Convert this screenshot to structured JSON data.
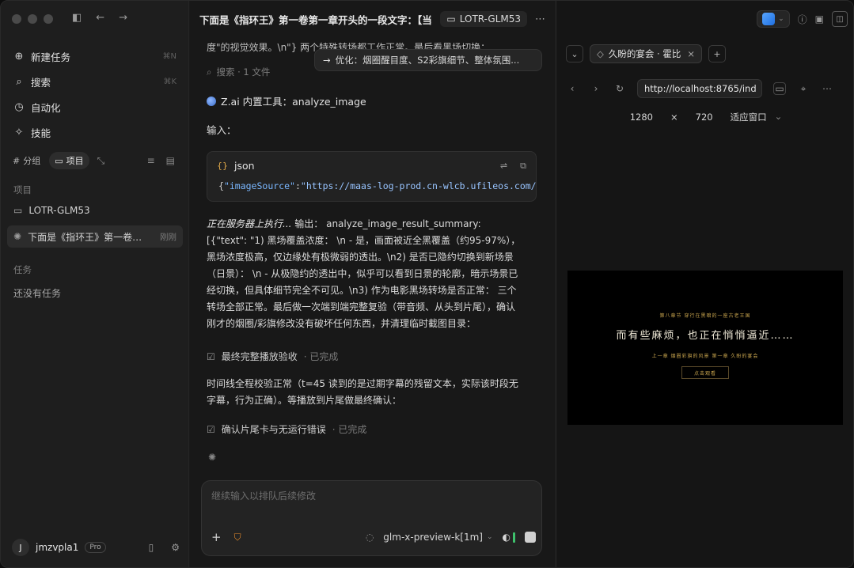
{
  "sidebar": {
    "nav": [
      {
        "label": "新建任务",
        "icon": "new-task-icon",
        "kbd": "⌘N"
      },
      {
        "label": "搜索",
        "icon": "search-icon",
        "kbd": "⌘K"
      },
      {
        "label": "自动化",
        "icon": "clock-icon",
        "kbd": ""
      },
      {
        "label": "技能",
        "icon": "sparkle-icon",
        "kbd": ""
      }
    ],
    "segments": {
      "group": "分组",
      "project": "项目"
    },
    "projects_label": "项目",
    "project_name": "LOTR-GLM53",
    "active_task": "下面是《指环王》第一卷第一章开头的一段文字",
    "active_task_time": "刚刚",
    "tasks_label": "任务",
    "tasks_empty": "还没有任务",
    "user": {
      "initial": "J",
      "name": "jmzvpla1",
      "badge": "Pro"
    }
  },
  "chat": {
    "title": "下面是《指环王》第一卷第一章开头的一段文字：【当袋底洞的...",
    "project_chip": "LOTR-GLM53",
    "first_line": "度\"的视觉效果。\\n\"} 两个特殊转场都工作正常。最后看黑场切换：",
    "opt_chip": "优化：烟圈醒目度、S2彩旗细节、整体氛围...",
    "search_row": "搜索 · 1 文件",
    "tool_label": "Z.ai 内置工具：analyze_image",
    "input_label": "输入：",
    "code_lang": "json",
    "code_key": "\"imageSource\"",
    "code_val": "\"https://maas-log-prod.cn-wlcb.ufileos.com/",
    "exec_prefix": "正在服务器上执行...",
    "exec_lines": [
      "输出： analyze_image_result_summary:",
      "[{\"text\": \"1) 黑场覆盖浓度： \\n - 是，画面被近全黑覆盖（约95-97%），",
      "黑场浓度极高，仅边缘处有极微弱的透出。\\n2) 是否已隐约切换到新场景",
      "（日景）： \\n - 从极隐约的透出中，似乎可以看到日景的轮廓，暗示场景已",
      "经切换，但具体细节完全不可见。\\n3) 作为电影黑场转场是否正常： 三个",
      "转场全部正常。最后做一次端到端完整复验（带音频、从头到片尾），确认",
      "刚才的烟圈/彩旗修改没有破坏任何东西，并清理临时截图目录："
    ],
    "task1": {
      "label": "最终完整播放验收",
      "status": "· 已完成"
    },
    "para2": [
      "时间线全程校验正常（t=45 读到的是过期字幕的残留文本，实际该时段无",
      "字幕，行为正确）。等播放到片尾做最终确认："
    ],
    "task2": {
      "label": "确认片尾卡与无运行错误",
      "status": "· 已完成"
    },
    "composer": {
      "placeholder": "继续输入以排队后续修改",
      "model": "glm-x-preview-k[1m]"
    }
  },
  "panel": {
    "tab_title": "久盼的宴会 · 霍比",
    "url": "http://localhost:8765/ind",
    "width": "1280",
    "times": "×",
    "height": "720",
    "fit": "适应窗口",
    "viewport": {
      "small_top": "第八章节  穿行在黑暗的一座古老王国",
      "main": "而有些麻烦，也正在悄悄逼近……",
      "small_bottom": "上一章  烟圈彩旗的风景  第一章  久盼的宴会",
      "button": "点击观看"
    }
  }
}
